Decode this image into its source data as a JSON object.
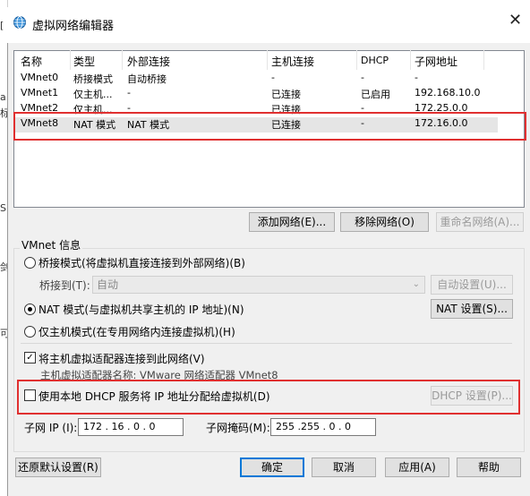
{
  "window": {
    "title": "虚拟网络编辑器",
    "close": "✕"
  },
  "edge_chars": [
    "[",
    "a",
    "标",
    "S",
    "剑",
    "可"
  ],
  "table": {
    "headers": [
      "名称",
      "类型",
      "外部连接",
      "主机连接",
      "DHCP",
      "子网地址"
    ],
    "rows": [
      [
        "VMnet0",
        "桥接模式",
        "自动桥接",
        "-",
        "-",
        "-"
      ],
      [
        "VMnet1",
        "仅主机...",
        "-",
        "已连接",
        "已启用",
        "192.168.10.0"
      ],
      [
        "VMnet2",
        "仅主机...",
        "-",
        "已连接",
        "-",
        "172.25.0.0"
      ],
      [
        "VMnet8",
        "NAT 模式",
        "NAT 模式",
        "已连接",
        "-",
        "172.16.0.0"
      ]
    ]
  },
  "buttons": {
    "add_network": "添加网络(E)...",
    "remove_network": "移除网络(O)",
    "rename_network": "重命名网络(A)...",
    "auto_settings": "自动设置(U)...",
    "nat_settings": "NAT 设置(S)...",
    "dhcp_settings": "DHCP 设置(P)...",
    "restore_defaults": "还原默认设置(R)",
    "ok": "确定",
    "cancel": "取消",
    "apply": "应用(A)",
    "help": "帮助"
  },
  "vmnet_info": {
    "group_label": "VMnet 信息",
    "radio_bridge": "桥接模式(将虚拟机直接连接到外部网络)(B)",
    "bridge_to_label": "桥接到(T):",
    "bridge_to_value": "自动",
    "radio_nat": "NAT 模式(与虚拟机共享主机的 IP 地址)(N)",
    "radio_host_only": "仅主机模式(在专用网络内连接虚拟机)(H)",
    "connect_adapter": "将主机虚拟适配器连接到此网络(V)",
    "adapter_name": "主机虚拟适配器名称: VMware 网络适配器 VMnet8",
    "use_dhcp": "使用本地 DHCP 服务将 IP 地址分配给虚拟机(D)",
    "subnet_ip_label": "子网 IP (I):",
    "subnet_ip_value": "172 . 16 . 0 . 0",
    "subnet_mask_label": "子网掩码(M):",
    "subnet_mask_value": "255 .255 . 0 . 0"
  },
  "colors": {
    "highlight_border": "#e03030",
    "selected_row": "#e5e5e5",
    "accent": "#0078d7"
  },
  "icons": {
    "title": "network-globe-icon",
    "combo": "chevron-down-icon"
  }
}
